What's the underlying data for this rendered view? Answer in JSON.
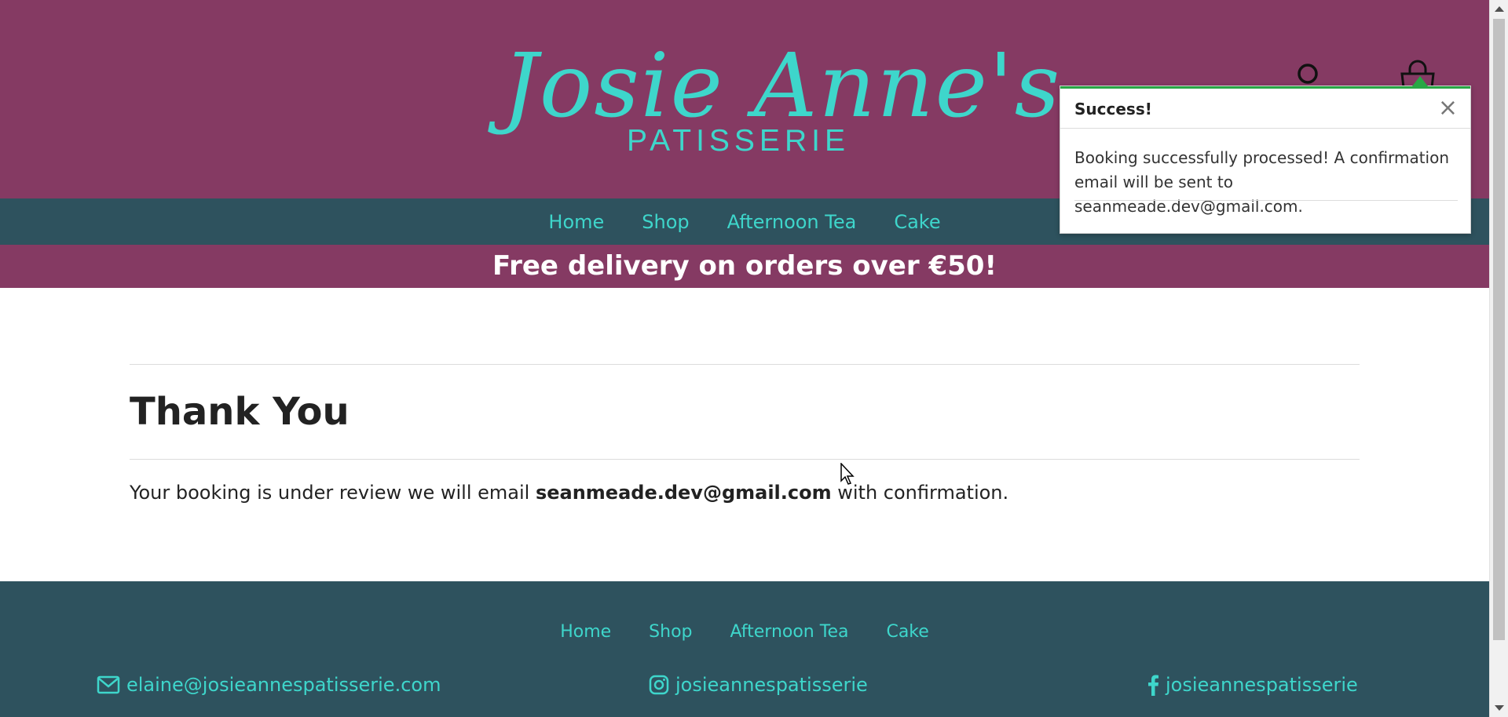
{
  "header": {
    "logo_script": "Josie Anne's",
    "logo_sub": "PATISSERIE",
    "account_icon": "account-icon",
    "cart_icon": "shopping-bag-icon"
  },
  "nav": {
    "items": [
      {
        "label": "Home"
      },
      {
        "label": "Shop"
      },
      {
        "label": "Afternoon Tea"
      },
      {
        "label": "Cake"
      }
    ]
  },
  "promo": {
    "text": "Free delivery on orders over €50!"
  },
  "main": {
    "title": "Thank You",
    "message_prefix": "Your booking is under review we will email ",
    "email": "seanmeade.dev@gmail.com",
    "message_suffix": " with confirmation."
  },
  "toast": {
    "title": "Success!",
    "close_label": "×",
    "body": "Booking successfully processed! A confirmation email will be sent to seanmeade.dev@gmail.com.",
    "accent_color": "#28a745"
  },
  "footer": {
    "nav": [
      {
        "label": "Home"
      },
      {
        "label": "Shop"
      },
      {
        "label": "Afternoon Tea"
      },
      {
        "label": "Cake"
      }
    ],
    "email": "elaine@josieannespatisserie.com",
    "instagram": "josieannespatisserie",
    "facebook": "josieannespatisserie"
  },
  "colors": {
    "brand_plum": "#853a63",
    "brand_teal_dark": "#2e525e",
    "accent_turquoise": "#3ed6cb"
  }
}
